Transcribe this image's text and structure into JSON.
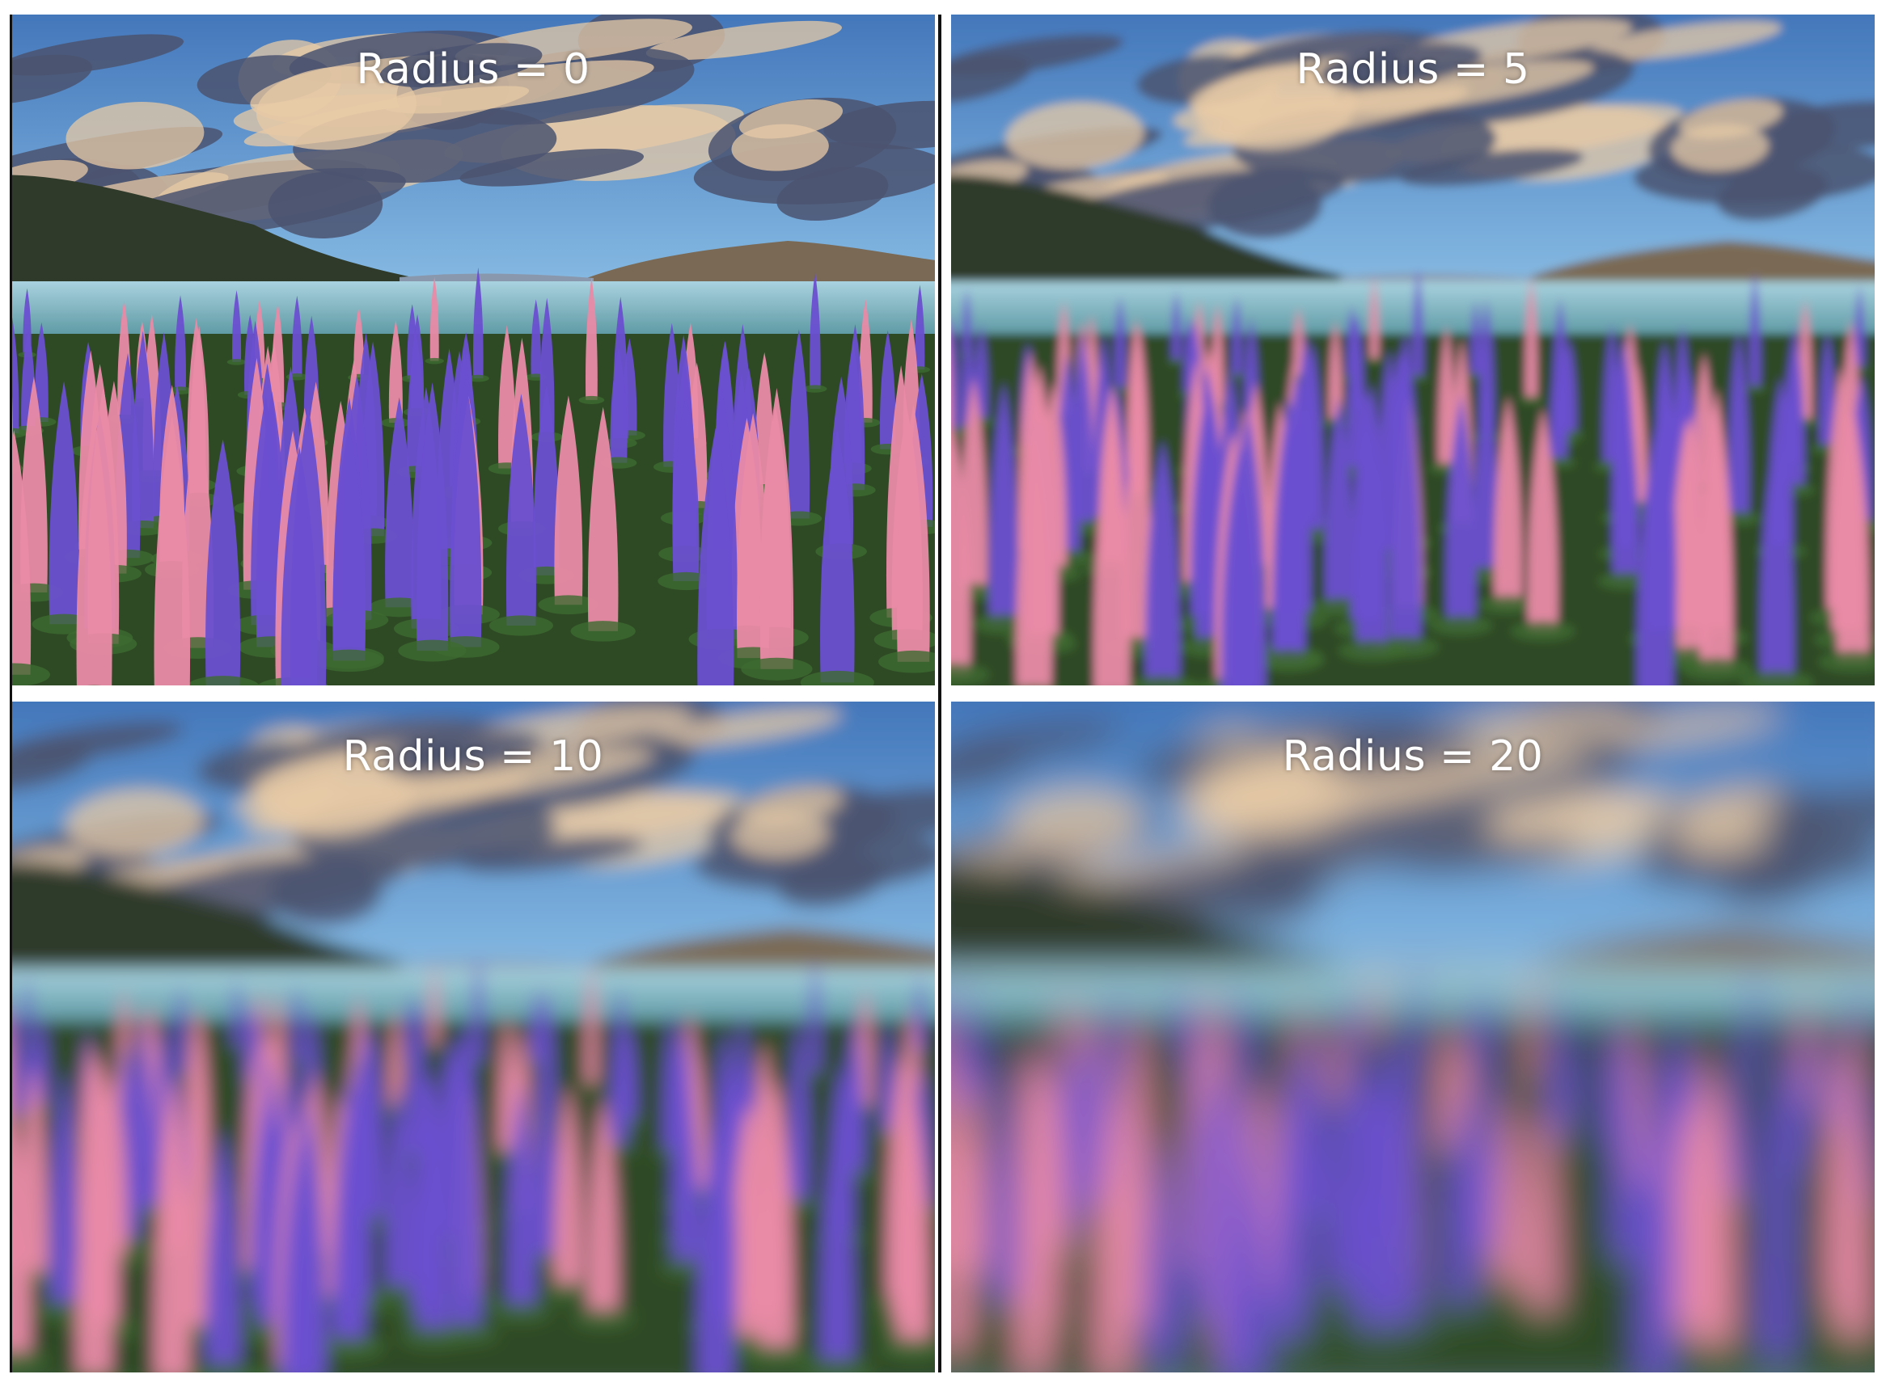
{
  "panels": [
    {
      "label": "Radius = 0",
      "blur_radius": 0
    },
    {
      "label": "Radius = 5",
      "blur_radius": 5
    },
    {
      "label": "Radius = 10",
      "blur_radius": 10
    },
    {
      "label": "Radius = 20",
      "blur_radius": 20
    }
  ],
  "colors": {
    "sky_top": "#3b6fb6",
    "sky_bottom": "#8fc3e8",
    "cloud_dark": "#4b5370",
    "cloud_light": "#e7c9a6",
    "mountain": "#2f3a2a",
    "lake": "#7fb4c8",
    "foliage": "#2e4a25",
    "lupine_purple": "#6a4fd0",
    "lupine_pink": "#e98aa6"
  }
}
